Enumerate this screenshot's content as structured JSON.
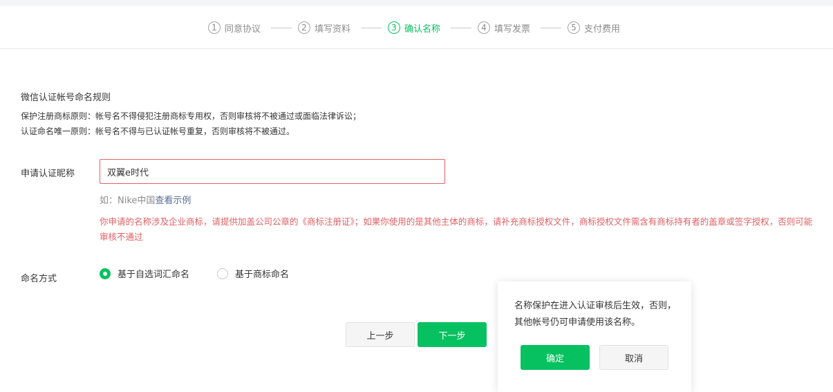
{
  "steps": [
    {
      "num": "1",
      "label": "同意协议"
    },
    {
      "num": "2",
      "label": "填写资料"
    },
    {
      "num": "3",
      "label": "确认名称"
    },
    {
      "num": "4",
      "label": "填写发票"
    },
    {
      "num": "5",
      "label": "支付费用"
    }
  ],
  "active_step": "3",
  "rules": {
    "title": "微信认证帐号命名规则",
    "line1": "保护注册商标原则：帐号名不得侵犯注册商标专用权，否则审核将不被通过或面临法律诉讼；",
    "line2": "认证命名唯一原则：帐号名不得与已认证帐号重复，否则审核将不被通过。"
  },
  "nickname": {
    "label": "申请认证昵称",
    "value": "双翼e时代",
    "example_prefix": "如：Nike中国",
    "example_link": "查看示例",
    "error": "你申请的名称涉及企业商标，请提供加盖公司公章的《商标注册证》；如果你使用的是其他主体的商标，请补充商标授权文件，商标授权文件需含有商标持有者的盖章或签字授权，否则可能审核不通过"
  },
  "naming": {
    "label": "命名方式",
    "options": [
      "基于自选词汇命名",
      "基于商标命名"
    ],
    "selected": "基于自选词汇命名"
  },
  "buttons": {
    "prev": "上一步",
    "next": "下一步"
  },
  "popover": {
    "text": "名称保护在进入认证审核后生效，否则，其他帐号仍可申请使用该名称。",
    "confirm": "确定",
    "cancel": "取消"
  },
  "colors": {
    "accent": "#07c160",
    "error": "#e15f63",
    "link": "#576b95"
  }
}
